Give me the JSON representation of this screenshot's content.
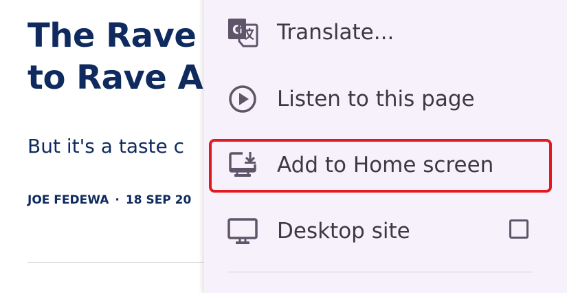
{
  "article": {
    "headline_line1": "The Rave",
    "headline_line2": "to Rave A",
    "subhead": "But it's a taste c",
    "author": "JOE FEDEWA",
    "separator": "·",
    "date": "18 SEP 20"
  },
  "menu": {
    "items": [
      {
        "label": "Translate...",
        "icon": "google-translate-icon"
      },
      {
        "label": "Listen to this page",
        "icon": "play-circle-icon"
      },
      {
        "label": "Add to Home screen",
        "icon": "add-to-home-screen-icon",
        "highlighted": true
      },
      {
        "label": "Desktop site",
        "icon": "desktop-monitor-icon",
        "checkbox_checked": false
      }
    ],
    "highlight_color": "#e2191e",
    "icon_color": "#5e5668",
    "background": "#f6f1fb"
  }
}
